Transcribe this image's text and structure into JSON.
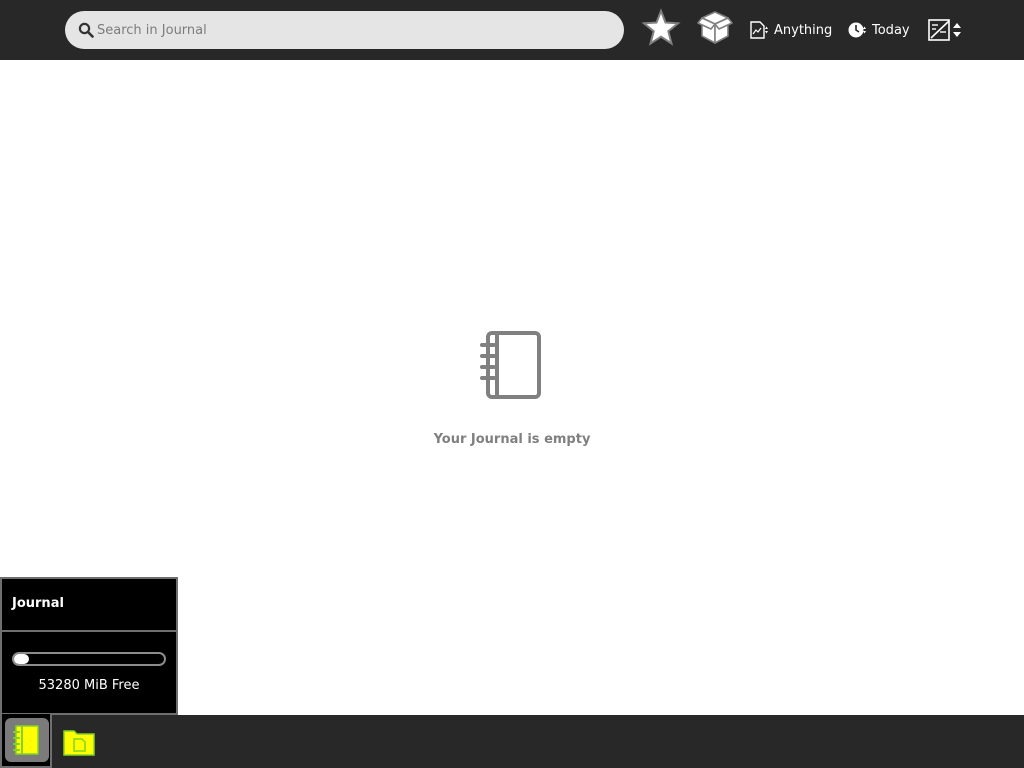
{
  "search": {
    "placeholder": "Search in Journal",
    "value": ""
  },
  "toolbar": {
    "favorites_icon": "star-icon",
    "view_icon": "box-icon",
    "filter_type": {
      "icon": "document-filter-icon",
      "label": "Anything"
    },
    "filter_date": {
      "icon": "clock-icon",
      "label": "Today"
    },
    "sort_icon": "sort-icon"
  },
  "main": {
    "empty_icon": "journal-notebook-icon",
    "empty_message": "Your Journal is empty"
  },
  "palette": {
    "title": "Journal",
    "storage_used_fraction": 0.1,
    "free_label": "53280 MiB Free"
  },
  "bottombar": {
    "items": [
      {
        "icon": "journal-notebook-icon",
        "active": true
      },
      {
        "icon": "folder-document-icon",
        "active": false
      }
    ]
  },
  "colors": {
    "toolbar_bg": "#282828",
    "accent_green": "#7fd427",
    "accent_yellow": "#ffff00",
    "empty_gray": "#808080"
  }
}
